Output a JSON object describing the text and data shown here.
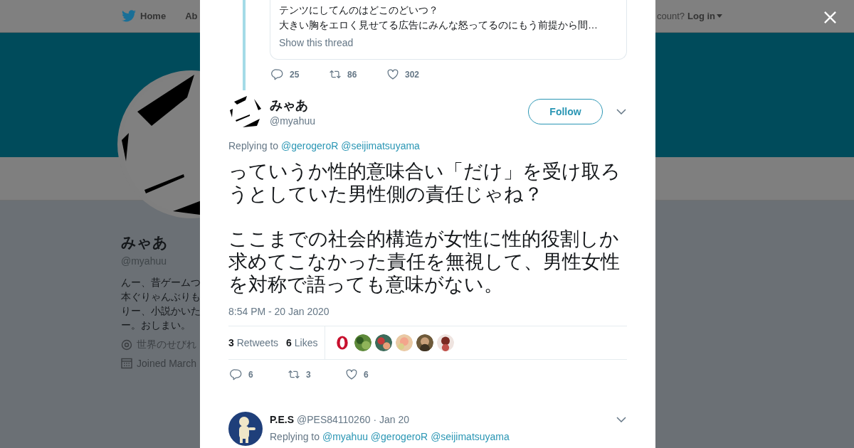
{
  "background_page": {
    "nav": {
      "items": [
        {
          "label": "Home"
        },
        {
          "label": "Ab"
        }
      ],
      "login_prompt": "count?",
      "login": "Log in"
    },
    "profile": {
      "avatar": {
        "kind": "picture"
      },
      "name": "みゃあ",
      "handle": "@myahuu",
      "bio": [
        "んー、昔ゲームつ",
        "本ぐりゃんぶりも",
        "りー、小説かいた",
        "ー。おしまい。"
      ],
      "location": "世界のせびれ",
      "joined": "Joined March"
    }
  },
  "modal": {
    "parent_tweet": {
      "quote_lines": [
        "テンツにしてんのはどこのどいつ？",
        "大きい胸をエロく見せてる広告にみんな怒ってるのにもう前提から間…"
      ],
      "show_thread": "Show this thread",
      "actions": [
        {
          "kind": "reply",
          "count": "25"
        },
        {
          "kind": "retweet",
          "count": "86"
        },
        {
          "kind": "like",
          "count": "302"
        }
      ]
    },
    "tweet": {
      "avatar": {
        "kind": "picture"
      },
      "name": "みゃあ",
      "handle": "@myahuu",
      "follow": "Follow",
      "replying_label": "Replying to",
      "mentions": [
        "@gerogeroR",
        "@seijimatsuyama"
      ],
      "paragraphs": [
        "っていうか性的意味合い「だけ」を受け取ろうとしていた男性側の責任じゃね？",
        "ここまでの社会的構造が女性に性的役割しか求めてこなかった責任を無視して、男性女性を対称で語っても意味がない。"
      ],
      "timestamp": "8:54 PM - 20 Jan 2020",
      "stats": [
        {
          "count": "3",
          "label": "Retweets"
        },
        {
          "count": "6",
          "label": "Likes"
        }
      ],
      "liked_by": [
        {
          "kind": "picture"
        },
        {
          "kind": "picture"
        },
        {
          "kind": "picture"
        },
        {
          "kind": "picture"
        },
        {
          "kind": "picture"
        },
        {
          "kind": "picture"
        }
      ],
      "actions": [
        {
          "kind": "reply",
          "count": "6"
        },
        {
          "kind": "retweet",
          "count": "3"
        },
        {
          "kind": "like",
          "count": "6"
        }
      ]
    },
    "reply": {
      "avatar": {
        "kind": "picture"
      },
      "name": "P.E.S",
      "handle": "@PES84110260",
      "date": "· Jan 20",
      "replying_label": "Replying to",
      "mentions": [
        "@myahuu",
        "@gerogeroR",
        "@seijimatsuyama"
      ]
    }
  }
}
